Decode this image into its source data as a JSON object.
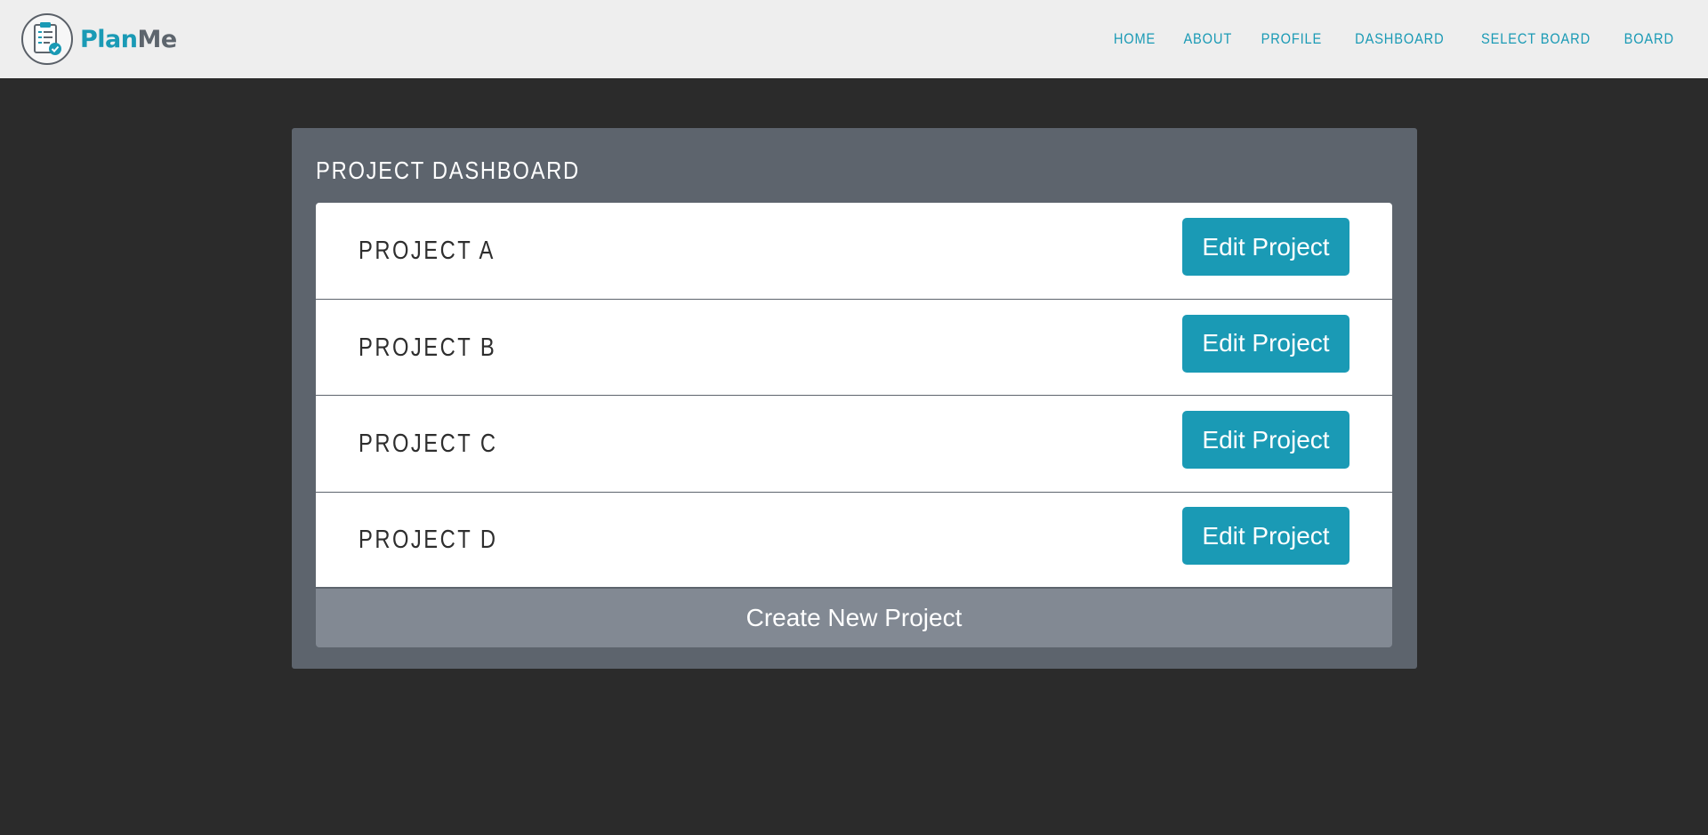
{
  "brand": {
    "name_part1": "Plan",
    "name_part2": "Me",
    "logo_icon": "clipboard-check-icon"
  },
  "nav": {
    "items": [
      {
        "label": "HOME"
      },
      {
        "label": "ABOUT"
      },
      {
        "label": "PROFILE"
      },
      {
        "label": "DASHBOARD"
      },
      {
        "label": "SELECT BOARD"
      },
      {
        "label": "BOARD"
      }
    ]
  },
  "dashboard": {
    "title": "PROJECT DASHBOARD",
    "projects": [
      {
        "name": "PROJECT A",
        "action_label": "Edit Project"
      },
      {
        "name": "PROJECT B",
        "action_label": "Edit Project"
      },
      {
        "name": "PROJECT C",
        "action_label": "Edit Project"
      },
      {
        "name": "PROJECT D",
        "action_label": "Edit Project"
      }
    ],
    "create_label": "Create New Project"
  },
  "colors": {
    "accent": "#1a9ab5",
    "navbar_bg": "#eeeeee",
    "page_bg": "#2b2b2b",
    "panel_bg": "#5d646d",
    "create_bg": "#828993"
  }
}
